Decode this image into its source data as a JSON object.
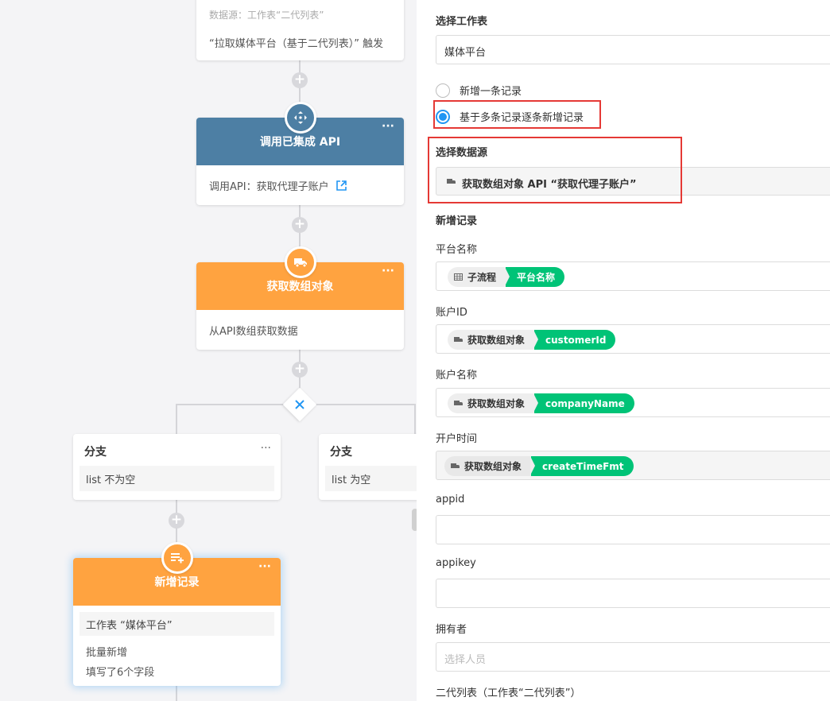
{
  "canvas": {
    "top_node": {
      "source": "数据源：工作表“二代列表”",
      "trigger": "“拉取媒体平台（基于二代列表）” 触发"
    },
    "api_node": {
      "title": "调用已集成 API",
      "body": "调用API：获取代理子账户",
      "color": "#4d7fa4"
    },
    "array_node": {
      "title": "获取数组对象",
      "body": "从API数组获取数据",
      "color": "#ffa340"
    },
    "branches": [
      {
        "title": "分支",
        "condition": "list 不为空"
      },
      {
        "title": "分支",
        "condition": "list 为空"
      }
    ],
    "add_node": {
      "title": "新增记录",
      "sheet": "工作表 “媒体平台”",
      "mode": "批量新增",
      "summary": "填写了6个字段"
    },
    "more_label": "···"
  },
  "panel": {
    "sheet_label": "选择工作表",
    "sheet_value": "媒体平台",
    "radio_single": "新增一条记录",
    "radio_multi": "基于多条记录逐条新增记录",
    "radio_selected": "multi",
    "source_label": "选择数据源",
    "source_value": "获取数组对象 API “获取代理子账户”",
    "records_label": "新增记录",
    "fields": [
      {
        "label": "平台名称",
        "source": "子流程",
        "value": "平台名称",
        "icon": "table-icon"
      },
      {
        "label": "账户ID",
        "source": "获取数组对象",
        "value": "customerId",
        "icon": "truck-icon"
      },
      {
        "label": "账户名称",
        "source": "获取数组对象",
        "value": "companyName",
        "icon": "truck-icon"
      },
      {
        "label": "开户时间",
        "source": "获取数组对象",
        "value": "createTimeFmt",
        "icon": "truck-icon"
      }
    ],
    "appid_label": "appid",
    "appikey_label": "appikey",
    "owner_label": "拥有者",
    "owner_placeholder": "选择人员",
    "relation_label": "二代列表（工作表“二代列表”）",
    "highlight_color": "#e53935",
    "accent_green": "#00c377",
    "accent_blue": "#2196f3"
  }
}
